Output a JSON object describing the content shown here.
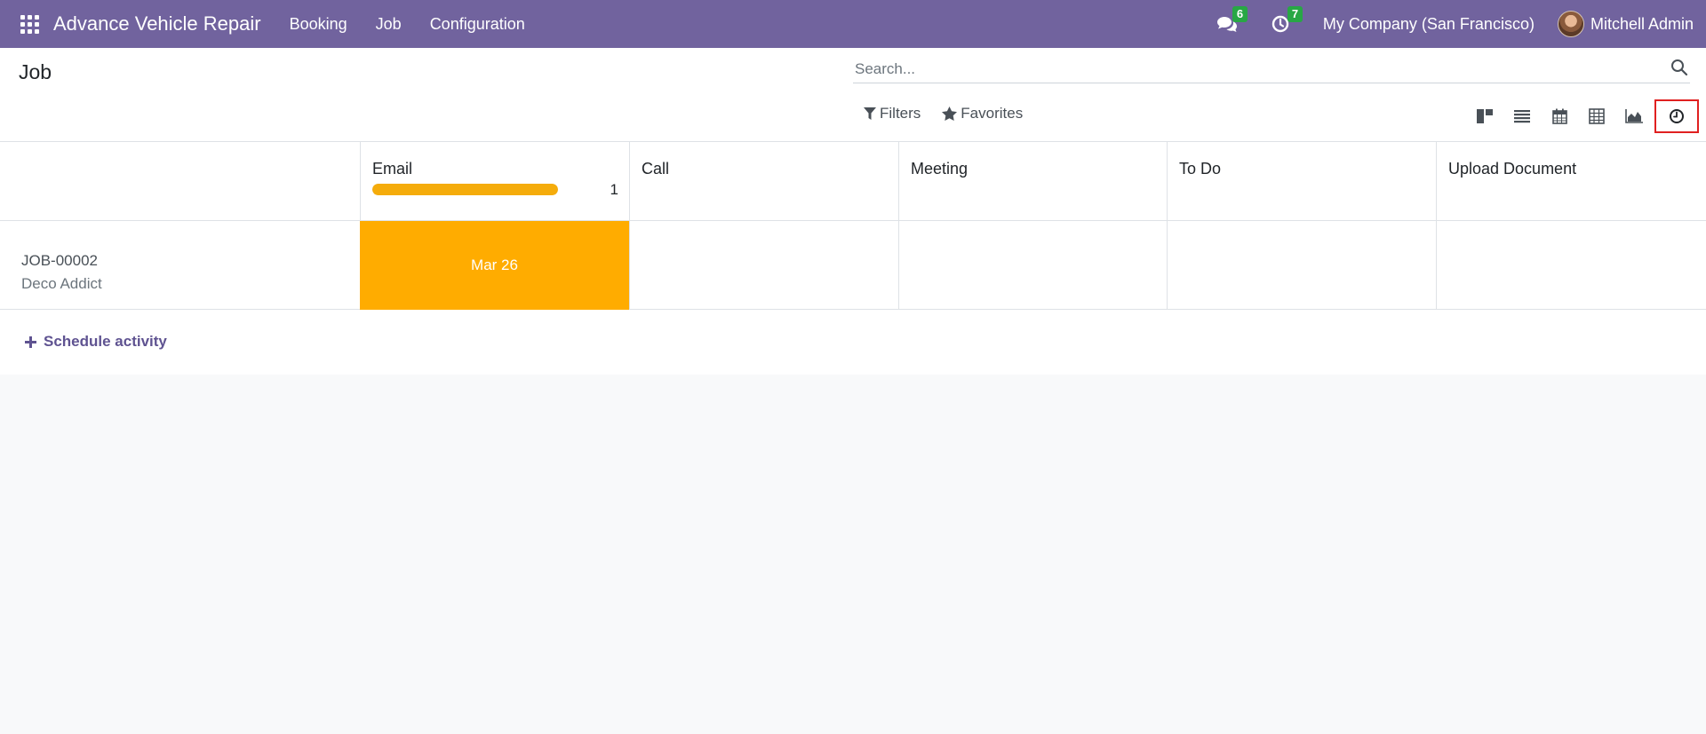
{
  "navbar": {
    "app_title": "Advance Vehicle Repair",
    "menu": [
      {
        "label": "Booking"
      },
      {
        "label": "Job"
      },
      {
        "label": "Configuration"
      }
    ],
    "messages_count": "6",
    "activities_count": "7",
    "company": "My Company (San Francisco)",
    "user_name": "Mitchell Admin"
  },
  "control": {
    "page_title": "Job",
    "search_placeholder": "Search...",
    "filters_label": "Filters",
    "favorites_label": "Favorites",
    "views": [
      "kanban",
      "list",
      "calendar",
      "pivot",
      "graph",
      "activity"
    ],
    "active_view": "activity"
  },
  "grid": {
    "columns": [
      {
        "title": "Email",
        "count": "1",
        "progress": 1.0
      },
      {
        "title": "Call"
      },
      {
        "title": "Meeting"
      },
      {
        "title": "To Do"
      },
      {
        "title": "Upload Document"
      }
    ],
    "rows": [
      {
        "name": "JOB-00002",
        "partner": "Deco Addict",
        "email_date": "Mar 26"
      }
    ],
    "schedule_label": "Schedule activity"
  },
  "colors": {
    "navbar": "#71639e",
    "planned": "#ffac00",
    "badge": "#28a745",
    "highlight": "#e02020",
    "link": "#5f5391"
  }
}
